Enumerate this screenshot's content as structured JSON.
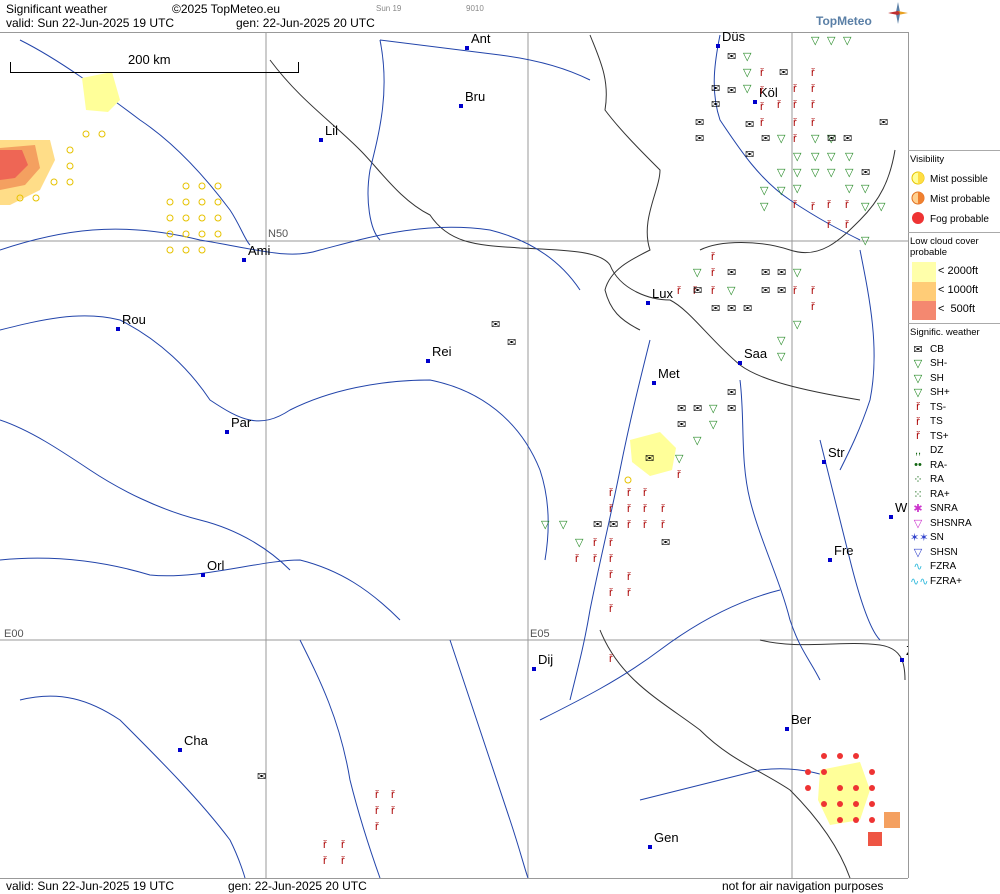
{
  "header": {
    "title": "Significant weather",
    "copyright": "©2025 TopMeteo.eu",
    "valid": "valid:  Sun  22-Jun-2025  19 UTC",
    "gen": "gen: 22-Jun-2025 20 UTC",
    "small1": "Sun 19",
    "small2": "9010",
    "logo": "TopMeteo"
  },
  "footer": {
    "valid": "valid:  Sun  22-Jun-2025  19 UTC",
    "gen": "gen: 22-Jun-2025 20 UTC",
    "note": "not for air navigation purposes"
  },
  "scale_label": "200 km",
  "grid_labels": {
    "n50": "N50",
    "e00": "E00",
    "e05": "E05"
  },
  "cities": [
    "Ant",
    "Düs",
    "Bru",
    "Köl",
    "Lil",
    "Ami",
    "Rou",
    "Rei",
    "Lux",
    "Saa",
    "Met",
    "Par",
    "Str",
    "Orl",
    "Fre",
    "W",
    "Dij",
    "Ber",
    "Cha",
    "Gen",
    "Z"
  ],
  "legend": {
    "visibility": {
      "title": "Visibility",
      "items": [
        "Mist possible",
        "Mist probable",
        "Fog probable"
      ]
    },
    "low_cloud": {
      "title": "Low cloud cover probable",
      "items": [
        "< 2000ft",
        "< 1000ft",
        "<  500ft"
      ]
    },
    "signif": {
      "title": "Signific. weather",
      "items": [
        {
          "label": "CB",
          "icon": "cb-icon",
          "color": "#000000"
        },
        {
          "label": "SH-",
          "icon": "shower-light-icon",
          "color": "#228822"
        },
        {
          "label": "SH",
          "icon": "shower-icon",
          "color": "#228822"
        },
        {
          "label": "SH+",
          "icon": "shower-heavy-icon",
          "color": "#228822"
        },
        {
          "label": "TS-",
          "icon": "thunderstorm-light-icon",
          "color": "#aa0000"
        },
        {
          "label": "TS",
          "icon": "thunderstorm-icon",
          "color": "#aa0000"
        },
        {
          "label": "TS+",
          "icon": "thunderstorm-heavy-icon",
          "color": "#aa0000"
        },
        {
          "label": "DZ",
          "icon": "drizzle-icon",
          "color": "#116611"
        },
        {
          "label": "RA-",
          "icon": "rain-light-icon",
          "color": "#116611"
        },
        {
          "label": "RA",
          "icon": "rain-icon",
          "color": "#116611"
        },
        {
          "label": "RA+",
          "icon": "rain-heavy-icon",
          "color": "#116611"
        },
        {
          "label": "SNRA",
          "icon": "snow-rain-icon",
          "color": "#cc33cc"
        },
        {
          "label": "SHSNRA",
          "icon": "snow-rain-shower-icon",
          "color": "#cc33cc"
        },
        {
          "label": "SN",
          "icon": "snow-icon",
          "color": "#3344cc"
        },
        {
          "label": "SHSN",
          "icon": "snow-shower-icon",
          "color": "#3344cc"
        },
        {
          "label": "FZRA",
          "icon": "freezing-rain-icon",
          "color": "#33bbdd"
        },
        {
          "label": "FZRA+",
          "icon": "freezing-rain-heavy-icon",
          "color": "#33bbdd"
        }
      ]
    }
  },
  "colors": {
    "river": "#2244aa",
    "border": "#333333",
    "grid": "#999999",
    "mist": "#ffff99",
    "fog": "#ee3333",
    "ts": "#aa0000",
    "sh": "#228822"
  }
}
